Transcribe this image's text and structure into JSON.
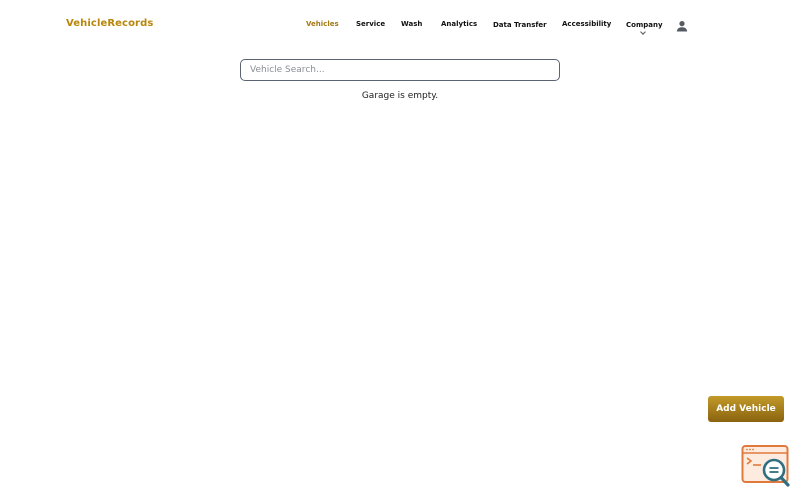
{
  "brand": {
    "name": "VehicleRecords"
  },
  "nav": {
    "vehicles": "Vehicles",
    "service": "Service",
    "wash": "Wash",
    "analytics": "Analytics",
    "data_transfer": "Data Transfer",
    "accessibility": "Accessibility",
    "company": "Company"
  },
  "search": {
    "placeholder": "Vehicle Search...",
    "value": ""
  },
  "main": {
    "empty_message": "Garage is empty."
  },
  "actions": {
    "add_vehicle": "Add Vehicle"
  },
  "icons": {
    "user": "user-icon",
    "dropdown": "chevron-down-icon",
    "console": "console-search-icon"
  },
  "colors": {
    "brand": "#b8860b",
    "active_nav": "#a47a16",
    "button": "#a67c1a",
    "console_icon": "#e07a3c"
  }
}
